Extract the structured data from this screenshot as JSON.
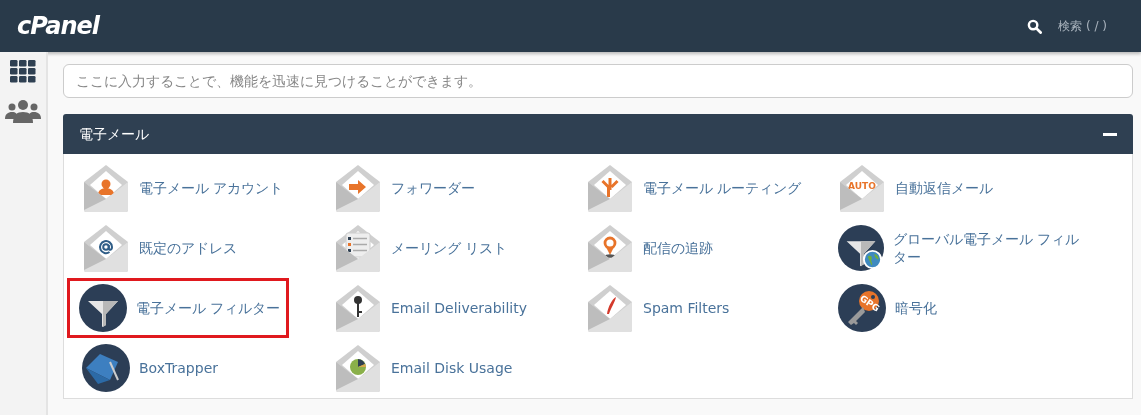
{
  "header": {
    "logo": "cPanel",
    "search_label": "検索 ( / )"
  },
  "sidebar": {
    "items": [
      {
        "kind": "grid",
        "selected": false
      },
      {
        "kind": "users",
        "selected": false
      }
    ]
  },
  "search": {
    "placeholder": "ここに入力することで、機能を迅速に見つけることができます。"
  },
  "panel": {
    "title": "電子メール",
    "expanded": true,
    "items": [
      {
        "label": "電子メール アカウント",
        "kind": "envelope",
        "highlighted": false
      },
      {
        "label": "フォワーダー",
        "kind": "envelope",
        "highlighted": false
      },
      {
        "label": "電子メール ルーティング",
        "kind": "envelope",
        "highlighted": false
      },
      {
        "label": "自動返信メール",
        "kind": "envelope",
        "highlighted": false,
        "icon_text": "AUTO"
      },
      {
        "label": "既定のアドレス",
        "kind": "envelope",
        "highlighted": false
      },
      {
        "label": "メーリング リスト",
        "kind": "envelope",
        "highlighted": false
      },
      {
        "label": "配信の追跡",
        "kind": "envelope",
        "highlighted": false
      },
      {
        "label": "グローバル電子メール フィルター",
        "kind": "disc",
        "highlighted": false
      },
      {
        "label": "電子メール フィルター",
        "kind": "disc",
        "highlighted": true
      },
      {
        "label": "Email Deliverability",
        "kind": "envelope",
        "highlighted": false
      },
      {
        "label": "Spam Filters",
        "kind": "envelope",
        "highlighted": false
      },
      {
        "label": "暗号化",
        "kind": "disc",
        "highlighted": false,
        "icon_text": "GPG"
      },
      {
        "label": "BoxTrapper",
        "kind": "disc",
        "highlighted": false
      },
      {
        "label": "Email Disk Usage",
        "kind": "envelope",
        "highlighted": false
      }
    ]
  }
}
